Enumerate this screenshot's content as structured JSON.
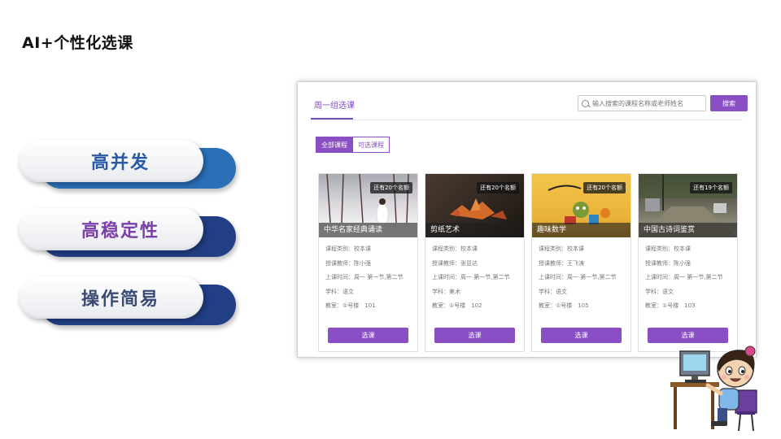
{
  "slide": {
    "title": "AI+个性化选课",
    "features": [
      "高并发",
      "高稳定性",
      "操作简易"
    ]
  },
  "panel": {
    "tab_label": "周一组选课",
    "search_placeholder": "输入搜索的课程名称或老师姓名",
    "search_button": "搜索",
    "filters": [
      "全部课程",
      "可选课程"
    ],
    "courses": [
      {
        "title": "中华名家经典诵读",
        "badge": "还有20个名额",
        "type": "课程类别：校本课",
        "teacher": "授课教师：陈小强",
        "time": "上课时间：周一 第一节,第二节",
        "subject": "学科：语文",
        "room": "教室：①号楼　101",
        "button": "选课"
      },
      {
        "title": "剪纸艺术",
        "badge": "还有20个名额",
        "type": "课程类别：校本课",
        "teacher": "授课教师：张显达",
        "time": "上课时间：周一 第一节,第二节",
        "subject": "学科：美术",
        "room": "教室：①号楼　102",
        "button": "选课"
      },
      {
        "title": "趣味数学",
        "badge": "还有20个名额",
        "type": "课程类别：校本课",
        "teacher": "授课教师：王飞涛",
        "time": "上课时间：周一 第一节,第二节",
        "subject": "学科：语文",
        "room": "教室：①号楼　105",
        "button": "选课"
      },
      {
        "title": "中国古诗词鉴赏",
        "badge": "还有19个名额",
        "type": "课程类别：校本课",
        "teacher": "授课教师：陈小强",
        "time": "上课时间：周一 第一节,第二节",
        "subject": "学科：语文",
        "room": "教室：①号楼　103",
        "button": "选课"
      }
    ]
  },
  "colors": {
    "accent": "#8a4fc4",
    "feature_blue": "#2a5aa6",
    "feature_purple": "#7a3fa8"
  }
}
